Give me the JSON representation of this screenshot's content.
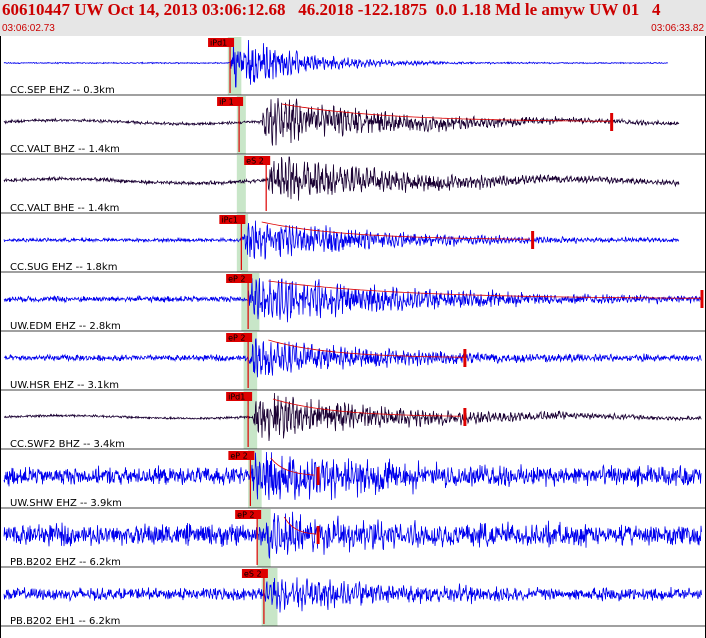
{
  "header": {
    "title": "60610447 UW Oct 14, 2013 03:06:12.68   46.2018 -122.1875  0.0 1.18 Md le amyw UW 01   4",
    "time_start": "03:06:02.73",
    "time_end": "03:06:33.82"
  },
  "colors": {
    "header_bg": "#e6e6e6",
    "header_text": "#cc0000",
    "trace_blue": "#0000ee",
    "trace_dark": "#1a0033",
    "pick_red": "#dd0000",
    "window_green": "#c8e6c8",
    "coda_red": "#dd0000"
  },
  "chart_data": {
    "type": "seismogram",
    "time_range": [
      "03:06:02.73",
      "03:06:33.82"
    ],
    "duration_s": 31.09,
    "channels": [
      {
        "label": "CC.SEP EHZ -- 0.3km",
        "pick": "iPd1",
        "pick_time_s": 10.1,
        "onset_s": 10.1,
        "signal_end_s": 29.5,
        "color": "blue",
        "noise": 0.02,
        "peak": 0.9,
        "decay": 3.0,
        "coda": false,
        "window": [
          10.0,
          10.6
        ]
      },
      {
        "label": "CC.VALT BHZ -- 1.4km",
        "pick": "iP 1",
        "pick_time_s": 10.5,
        "onset_s": 11.5,
        "signal_end_s": 30.0,
        "color": "dark",
        "noise": 0.05,
        "peak": 0.75,
        "decay": 6.0,
        "coda": true,
        "coda_end_s": 27.0,
        "window": [
          10.4,
          10.8
        ]
      },
      {
        "label": "CC.VALT BHE -- 1.4km",
        "pick": "eS 2",
        "pick_time_s": 11.7,
        "onset_s": 11.7,
        "signal_end_s": 30.0,
        "color": "dark",
        "noise": 0.06,
        "peak": 0.7,
        "decay": 7.0,
        "coda": false,
        "window": [
          10.4,
          10.8
        ]
      },
      {
        "label": "CC.SUG EHZ -- 1.8km",
        "pick": "iPc1",
        "pick_time_s": 10.6,
        "onset_s": 10.6,
        "signal_end_s": 30.0,
        "color": "blue",
        "noise": 0.06,
        "peak": 0.7,
        "decay": 6.0,
        "coda": true,
        "coda_end_s": 23.5,
        "window": [
          10.4,
          10.9
        ]
      },
      {
        "label": "UW.EDM EHZ -- 2.8km",
        "pick": "eP 2",
        "pick_time_s": 10.9,
        "onset_s": 10.9,
        "signal_end_s": 31.0,
        "color": "blue",
        "noise": 0.1,
        "peak": 0.75,
        "decay": 8.0,
        "coda": true,
        "coda_end_s": 31.0,
        "window": [
          10.6,
          11.4
        ]
      },
      {
        "label": "UW.HSR EHZ -- 3.1km",
        "pick": "eP 2",
        "pick_time_s": 10.9,
        "onset_s": 10.9,
        "signal_end_s": 31.0,
        "color": "blue",
        "noise": 0.1,
        "peak": 0.6,
        "decay": 7.0,
        "coda": true,
        "coda_end_s": 20.5,
        "window": [
          10.7,
          11.3
        ]
      },
      {
        "label": "CC.SWF2 BHZ -- 3.4km",
        "pick": "iPd1",
        "pick_time_s": 10.9,
        "onset_s": 11.1,
        "signal_end_s": 31.0,
        "color": "dark",
        "noise": 0.04,
        "peak": 0.7,
        "decay": 7.0,
        "coda": true,
        "coda_end_s": 20.5,
        "window": [
          10.7,
          11.3
        ]
      },
      {
        "label": "UW.SHW EHZ -- 3.9km",
        "pick": "eP 2",
        "pick_time_s": 11.0,
        "onset_s": 11.0,
        "signal_end_s": 31.0,
        "color": "blue",
        "noise": 0.3,
        "peak": 0.8,
        "decay": 7.0,
        "coda": true,
        "coda_end_s": 14.0,
        "window": [
          10.9,
          11.5
        ]
      },
      {
        "label": "PB.B202 EHZ -- 6.2km",
        "pick": "eP 2",
        "pick_time_s": 11.3,
        "onset_s": 11.6,
        "signal_end_s": 31.0,
        "color": "blue",
        "noise": 0.35,
        "peak": 0.6,
        "decay": 7.0,
        "coda": true,
        "coda_end_s": 14.0,
        "window": [
          11.3,
          11.9
        ]
      },
      {
        "label": "PB.B202 EH1 -- 6.2km",
        "pick": "eS 2",
        "pick_time_s": 11.6,
        "onset_s": 11.6,
        "signal_end_s": 31.0,
        "color": "blue",
        "noise": 0.2,
        "peak": 0.5,
        "decay": 7.0,
        "coda": false,
        "window": [
          11.5,
          12.2
        ]
      }
    ]
  }
}
